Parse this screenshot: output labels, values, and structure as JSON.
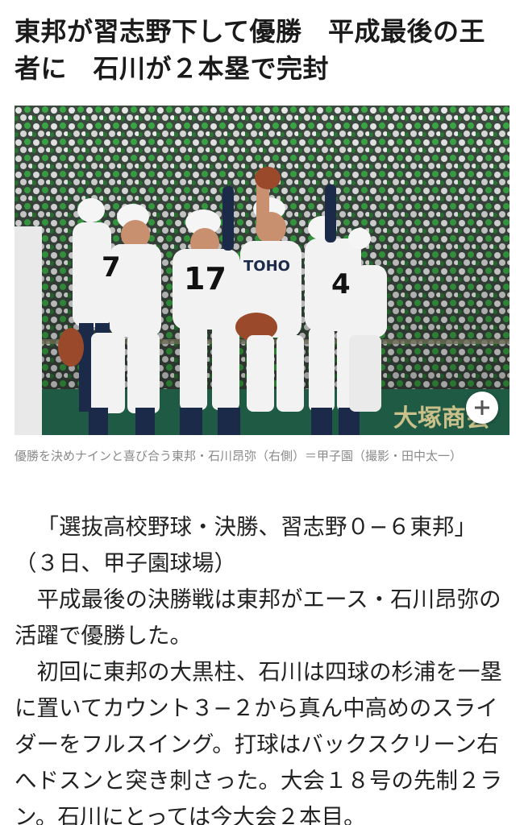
{
  "article": {
    "headline": "東邦が習志野下して優勝　平成最後の王\n者に　石川が２本塁で完封",
    "photo": {
      "uniform_numbers": [
        "7",
        "17",
        "4"
      ],
      "team_name": "TOHO",
      "background_sign": "大塚商会",
      "expand_icon": "plus-icon"
    },
    "caption": "優勝を決めナインと喜び合う東邦・石川昂弥（右側）＝甲子園（撮影・田中太一）",
    "paragraphs": [
      "「選抜高校野球・決勝、習志野０−６東邦」（３日、甲子園球場）",
      "平成最後の決勝戦は東邦がエース・石川昂弥の活躍で優勝した。",
      "初回に東邦の大黒柱、石川は四球の杉浦を一塁に置いてカウント３−２から真ん中高めのスライダーをフルスイング。打球はバックスクリーン右へドスンと突き刺さった。大会１８号の先制２ラン。石川にとっては今大会２本目。"
    ]
  },
  "colors": {
    "headline": "#1a1a1a",
    "caption": "#8a8a8a",
    "body": "#222222",
    "uniform": "#f2f2f2",
    "stand_green": "#3aa845"
  }
}
